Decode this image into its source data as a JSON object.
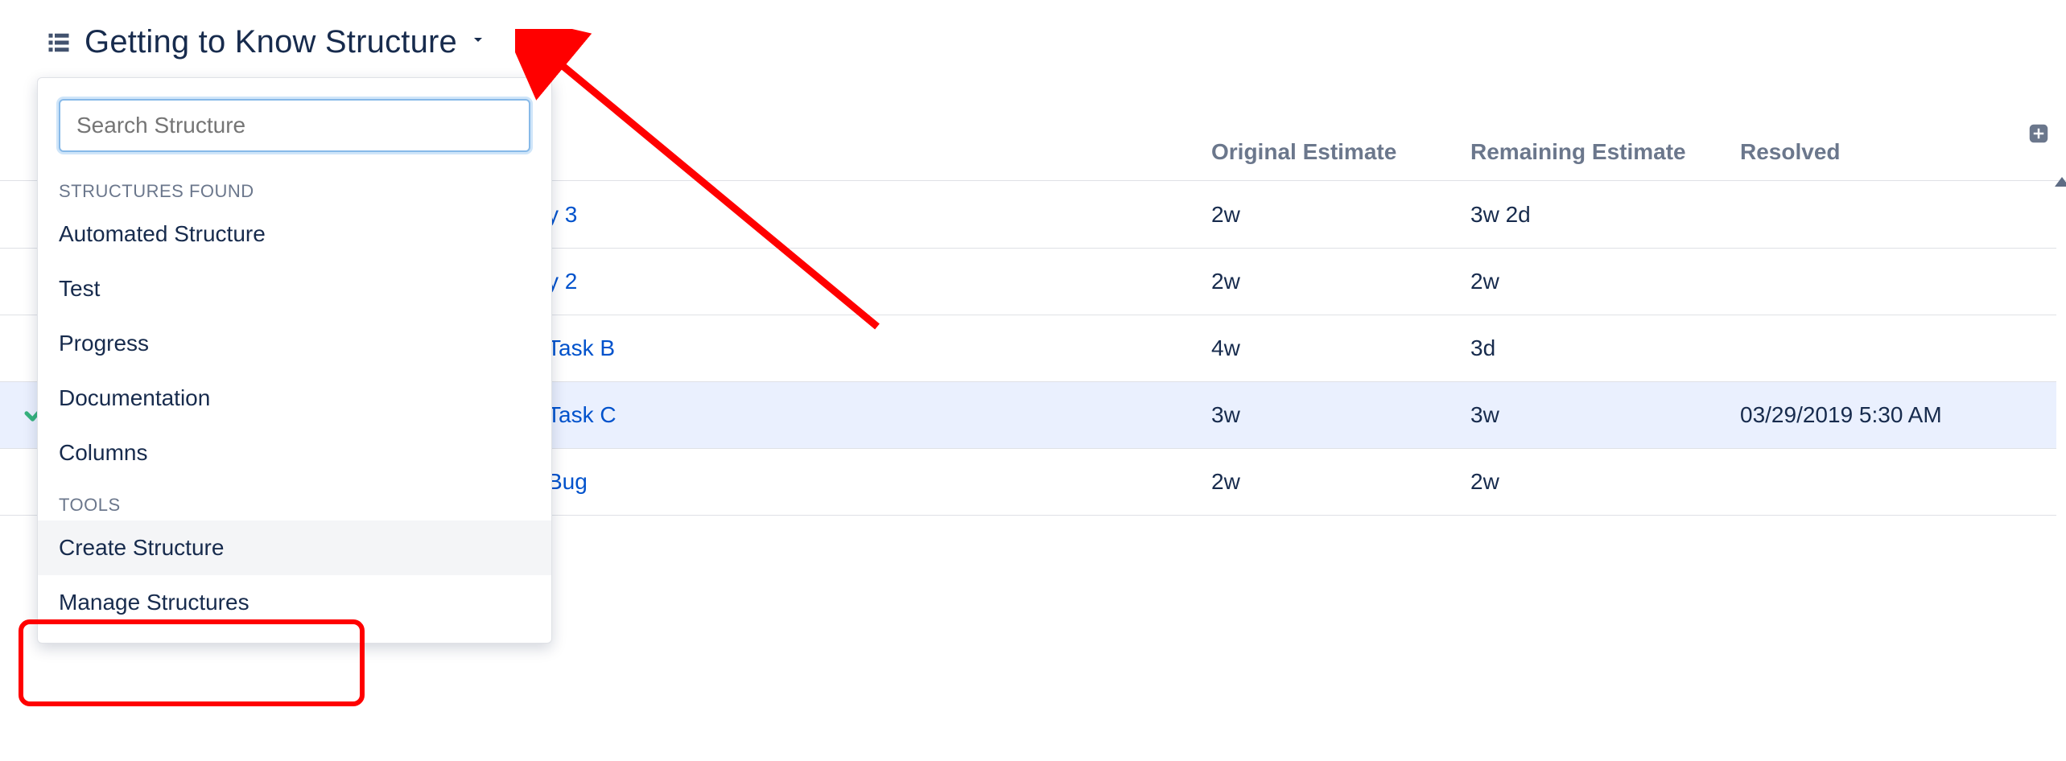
{
  "title": "Getting to Know Structure",
  "columns": {
    "original_estimate": "Original Estimate",
    "remaining_estimate": "Remaining Estimate",
    "resolved": "Resolved"
  },
  "rows": [
    {
      "name_fragment": "y 3",
      "original": "2w",
      "remaining": "3w 2d",
      "resolved": "",
      "highlight": false,
      "check": false
    },
    {
      "name_fragment": "y 2",
      "original": "2w",
      "remaining": "2w",
      "resolved": "",
      "highlight": false,
      "check": false
    },
    {
      "name_fragment": "Task B",
      "original": "4w",
      "remaining": "3d",
      "resolved": "",
      "highlight": false,
      "check": false
    },
    {
      "name_fragment": "Task C",
      "original": "3w",
      "remaining": "3w",
      "resolved": "03/29/2019 5:30 AM",
      "highlight": true,
      "check": true
    },
    {
      "name_fragment": "Bug",
      "original": "2w",
      "remaining": "2w",
      "resolved": "",
      "highlight": false,
      "check": false
    }
  ],
  "dropdown": {
    "search_placeholder": "Search Structure",
    "section_found_label": "STRUCTURES FOUND",
    "found": [
      "Automated Structure",
      "Test",
      "Progress",
      "Documentation",
      "Columns"
    ],
    "section_tools_label": "TOOLS",
    "tools": [
      "Create Structure",
      "Manage Structures"
    ],
    "hovered_tool_index": 0
  }
}
